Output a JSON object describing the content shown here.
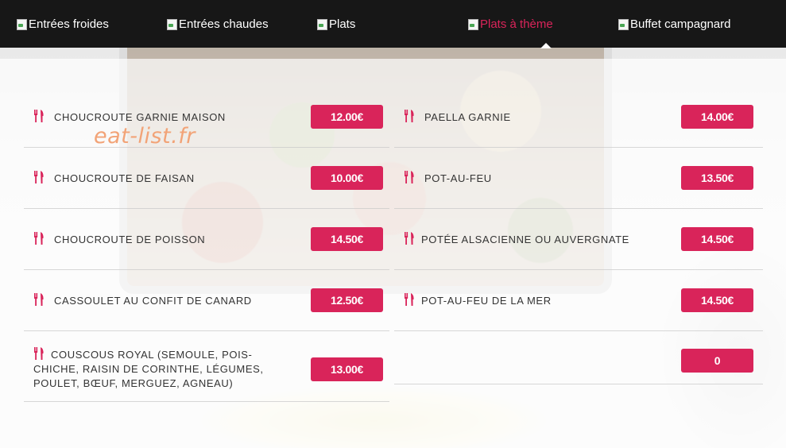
{
  "nav": {
    "items": [
      {
        "label": "Entrées froides"
      },
      {
        "label": "Entrées chaudes"
      },
      {
        "label": "Plats"
      },
      {
        "label": "Plats à thème"
      },
      {
        "label": "Buffet campagnard"
      }
    ],
    "active_index": 3
  },
  "watermark": "eat-list.fr",
  "menu": {
    "left": [
      {
        "name": "CHOUCROUTE GARNIE MAISON",
        "price": "12.00€"
      },
      {
        "name": "CHOUCROUTE DE FAISAN",
        "price": "10.00€"
      },
      {
        "name": "CHOUCROUTE DE POISSON",
        "price": "14.50€"
      },
      {
        "name": "CASSOULET AU CONFIT DE CANARD",
        "price": "12.50€"
      },
      {
        "name": "COUSCOUS ROYAL (SEMOULE, POIS-CHICHE, RAISIN DE CORINTHE, LÉGUMES, POULET, BŒUF, MERGUEZ, AGNEAU)",
        "price": "13.00€"
      }
    ],
    "right": [
      {
        "name": "PAELLA GARNIE",
        "price": "14.00€"
      },
      {
        "name": "POT-AU-FEU",
        "price": "13.50€"
      },
      {
        "name": "POTÉE ALSACIENNE OU AUVERGNATE",
        "price": "14.50€"
      },
      {
        "name": "POT-AU-FEU DE LA MER",
        "price": "14.50€"
      },
      {
        "name": "",
        "price": "0"
      }
    ]
  },
  "colors": {
    "accent": "#d9245a",
    "nav_bg": "#171717",
    "watermark": "#f2a377"
  },
  "icons": {
    "dish": "fork-knife-icon",
    "nav": "broken-image-icon"
  }
}
